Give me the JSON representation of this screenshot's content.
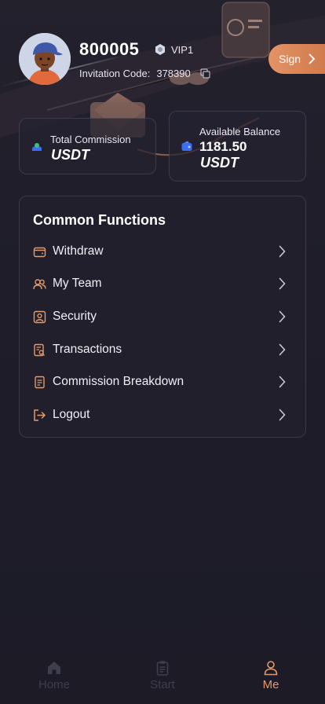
{
  "profile": {
    "user_id": "800005",
    "vip_label": "VIP1",
    "invitation_label": "Invitation Code:",
    "invitation_code": "378390",
    "sign_label": "Sign"
  },
  "balances": {
    "commission": {
      "label": "Total Commission",
      "value": "",
      "unit": "USDT"
    },
    "available": {
      "label": "Available Balance",
      "value": "1181.50",
      "unit": "USDT"
    }
  },
  "functions": {
    "title": "Common Functions",
    "items": [
      {
        "label": "Withdraw",
        "icon": "wallet-icon"
      },
      {
        "label": "My Team",
        "icon": "team-icon"
      },
      {
        "label": "Security",
        "icon": "security-icon"
      },
      {
        "label": "Transactions",
        "icon": "transactions-icon"
      },
      {
        "label": "Commission Breakdown",
        "icon": "document-icon"
      },
      {
        "label": "Logout",
        "icon": "logout-icon"
      }
    ]
  },
  "tabbar": {
    "items": [
      {
        "label": "Home",
        "icon": "home-icon",
        "active": false
      },
      {
        "label": "Start",
        "icon": "clipboard-icon",
        "active": false
      },
      {
        "label": "Me",
        "icon": "user-icon",
        "active": true
      }
    ]
  },
  "colors": {
    "background": "#1d1c28",
    "accent": "#e39a6c",
    "sign_button": "#d9865a",
    "inactive_tab": "#3f3e4c"
  }
}
